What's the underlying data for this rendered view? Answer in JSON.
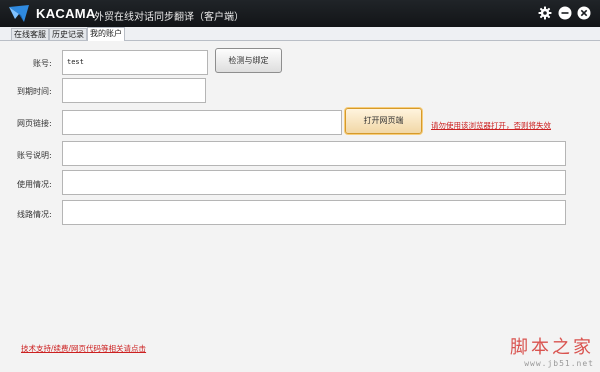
{
  "titlebar": {
    "app_name": "KACAMA",
    "subtitle": "外贸在线对话同步翻译（客户端）"
  },
  "tabs": [
    {
      "label": "在线客服",
      "active": false
    },
    {
      "label": "历史记录",
      "active": false
    },
    {
      "label": "我的账户",
      "active": true
    }
  ],
  "form": {
    "account_label": "账号:",
    "account_value": "test",
    "check_bind_label": "检测与绑定",
    "expire_label": "到期时间:",
    "expire_value": "",
    "webpage_link_label": "网页链接:",
    "webpage_link_value": "",
    "open_webpage_label": "打开网页端",
    "open_warning": "请勿使用该浏览器打开，否则将失效",
    "account_desc_label": "账号说明:",
    "account_desc_value": "",
    "usage_label": "使用情况:",
    "usage_value": "",
    "line_label": "线路情况:",
    "line_value": ""
  },
  "footer": {
    "support_link": "技术支持/续费/网页代码等相关请点击"
  },
  "watermark": {
    "main": "脚本之家",
    "url": "www.jb51.net"
  },
  "colors": {
    "titlebar": "#1a1d21",
    "link_red": "#cc2020",
    "highlight_button": "#f1d7a6"
  }
}
